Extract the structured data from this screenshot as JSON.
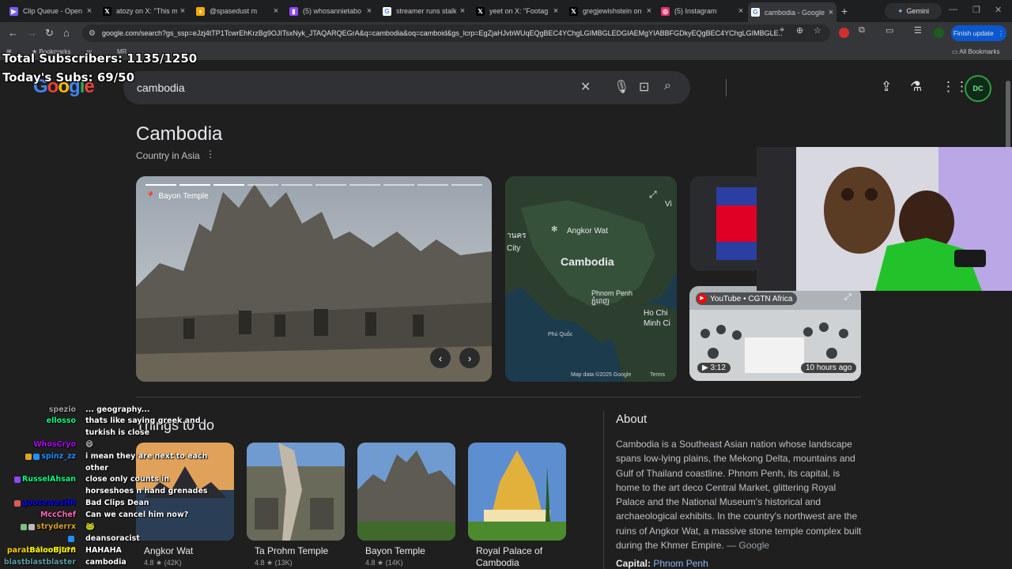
{
  "browser": {
    "tabs": [
      {
        "title": "Clip Queue - Open",
        "icon_color": "#7b5cff",
        "icon": "clip-queue-icon"
      },
      {
        "title": "atozy on X: \"This m",
        "icon_color": "#000000",
        "icon": "x-icon"
      },
      {
        "title": "@spasedust m",
        "icon_color": "#f9ab00",
        "icon": "bell-icon"
      },
      {
        "title": "(5) whosannietabo",
        "icon_color": "#9146ff",
        "icon": "twitch-icon"
      },
      {
        "title": "streamer runs stalk",
        "icon_color": "#ffffff",
        "icon": "google-icon"
      },
      {
        "title": "yeet on X: \"Footag",
        "icon_color": "#000000",
        "icon": "x-icon"
      },
      {
        "title": "gregjewishstein on",
        "icon_color": "#000000",
        "icon": "x-icon"
      },
      {
        "title": "(5) Instagram",
        "icon_color": "#e1306c",
        "icon": "instagram-icon"
      },
      {
        "title": "cambodia - Google",
        "icon_color": "#ffffff",
        "icon": "google-icon"
      }
    ],
    "gemini_label": "Gemini",
    "url": "google.com/search?gs_ssp=eJzj4tTP1TcwrEhKrzBg9OJITsxNyk_JTAQARQEGrA&q=cambodia&oq=camboid&gs_lcrp=EgZjaHJvbWUqEQgBEC4YChgLGIMBGLEDGIAEMgYIABBFGDkyEQgBEC4YChgLGIMBGLE...",
    "finish_update_label": "Finish update",
    "bookmarks": [
      "Bookmarks",
      "w",
      "MR"
    ],
    "all_bookmarks_label": "All Bookmarks"
  },
  "overlay": {
    "total_subscribers": "Total Subscribers: 1135/1250",
    "todays_subs": "Today's Subs: 69/50"
  },
  "google": {
    "logo_text": "Google",
    "query": "cambodia",
    "avatar_text": "DC"
  },
  "knowledge_panel": {
    "title": "Cambodia",
    "subtitle": "Country in Asia",
    "main_photo_label": "Bayon Temple",
    "map": {
      "labels": [
        "Angkor Wat",
        "Cambodia",
        "Phnom Penh",
        "ភ្នំពេញ",
        "Ho Chi",
        "Minh Ci",
        "Phú Quốc",
        "City",
        "านคร",
        "Vi"
      ],
      "attribution": "Map data ©2025 Google",
      "terms": "Terms"
    },
    "video": {
      "source": "YouTube • CGTN Africa",
      "duration": "3:12",
      "age": "10 hours ago"
    }
  },
  "things_to_do": {
    "title": "Things to do",
    "items": [
      {
        "name": "Angkor Wat",
        "rating": "4.8 ★ (42K)"
      },
      {
        "name": "Ta Prohm Temple",
        "rating": "4.8 ★ (13K)"
      },
      {
        "name": "Bayon Temple",
        "rating": "4.8 ★ (14K)"
      },
      {
        "name": "Royal Palace of Cambodia",
        "rating": ""
      }
    ]
  },
  "about": {
    "title": "About",
    "text": "Cambodia is a Southeast Asian nation whose landscape spans low-lying plains, the Mekong Delta, mountains and Gulf of Thailand coastline. Phnom Penh, its capital, is home to the art deco Central Market, glittering Royal Palace and the National Museum's historical and archaeological exhibits. In the country's northwest are the ruins of Angkor Wat, a massive stone temple complex built during the Khmer Empire.",
    "source": "— Google",
    "capital_label": "Capital:",
    "capital_value": "Phnom Penh"
  },
  "chat": [
    {
      "user": "spezio",
      "color": "#9aa0a6",
      "msg": "... geography..."
    },
    {
      "user": "ellosso",
      "color": "#00ff7f",
      "msg": "thats like saying greek and turkish is close"
    },
    {
      "user": "WhosCryo",
      "color": "#b000ff",
      "msg": "😄"
    },
    {
      "user": "spinz_zz",
      "color": "#1e90ff",
      "msg": "i mean they are next to each other"
    },
    {
      "user": "RusselAhsan",
      "color": "#00ff7f",
      "msg": "close only counts in horseshoes n hand grenades"
    },
    {
      "user": "goosewasHR",
      "color": "#0000ff",
      "msg": "Bad Clips Dean"
    },
    {
      "user": "MccChef",
      "color": "#ff69b4",
      "msg": "Can we cancel him now?"
    },
    {
      "user": "stryderrx",
      "color": "#daa520",
      "msg": "🐸"
    },
    {
      "user": "parabellum8888",
      "color": "#ffd400",
      "msg": "deansoracist"
    },
    {
      "user": "BalooBjurn",
      "color": "#ffff00",
      "msg": "HAHAHA"
    },
    {
      "user": "blastblastblaster",
      "color": "#5f9ea0",
      "msg": "cambodia"
    }
  ]
}
